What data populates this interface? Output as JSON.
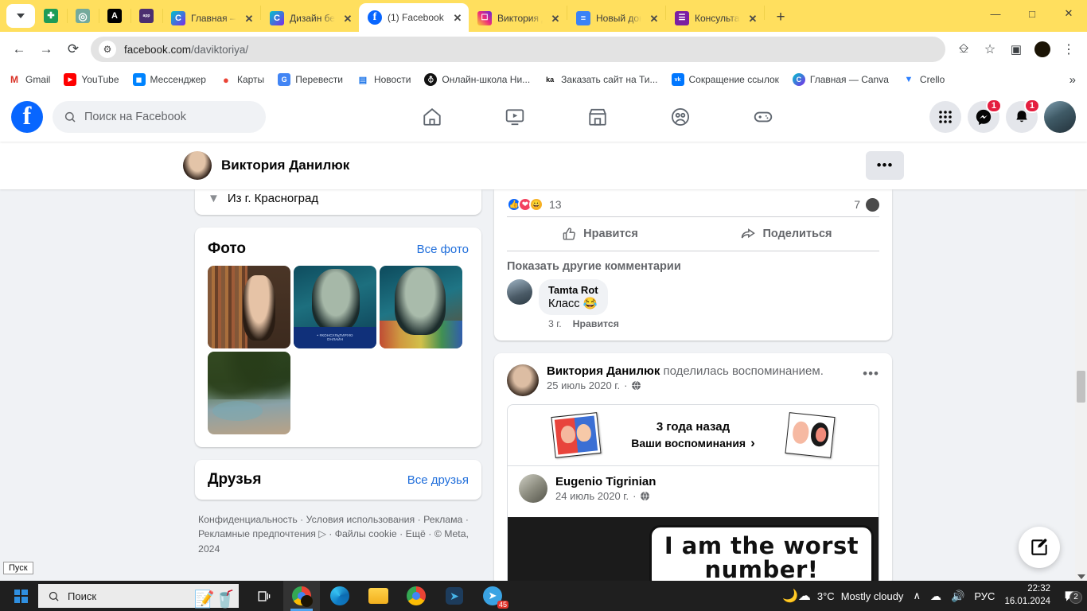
{
  "browser": {
    "tabs": [
      {
        "title": "",
        "favicon": "sheets-icon",
        "pinned": true,
        "color": "#1e9b57",
        "glyph": "✚"
      },
      {
        "title": "",
        "favicon": "chatgpt-icon",
        "pinned": true,
        "color": "#74aa9c",
        "glyph": "◎"
      },
      {
        "title": "",
        "favicon": "adobe-a-icon",
        "pinned": true,
        "color": "#000000",
        "glyph": "A"
      },
      {
        "title": "",
        "favicon": "purple-app-icon",
        "pinned": true,
        "color": "#4b2e70",
        "glyph": ""
      },
      {
        "title": "Главная — Canva",
        "favicon": "canva-icon",
        "pinned": false,
        "color": "#7d2ae8",
        "glyph": "C",
        "active": false
      },
      {
        "title": "Дизайн без названия",
        "favicon": "canva-icon",
        "pinned": false,
        "color": "#7d2ae8",
        "glyph": "C",
        "active": false
      },
      {
        "title": "(1) Facebook",
        "favicon": "facebook-icon",
        "pinned": false,
        "color": "#0866ff",
        "glyph": "f",
        "active": true
      },
      {
        "title": "Виктория Данилюк",
        "favicon": "instagram-icon",
        "pinned": false,
        "color": "#e1306c",
        "glyph": "▢",
        "active": false
      },
      {
        "title": "Новый документ",
        "favicon": "docs-icon",
        "pinned": false,
        "color": "#3b82f6",
        "glyph": "≡",
        "active": false
      },
      {
        "title": "Консультации",
        "favicon": "forms-icon",
        "pinned": false,
        "color": "#7b1fa2",
        "glyph": "☰",
        "active": false
      }
    ],
    "close_label": "✕",
    "new_tab_label": "+",
    "window_controls": {
      "minimize": "—",
      "maximize": "□",
      "close": "✕"
    },
    "nav": {
      "back": "←",
      "forward": "→",
      "reload": "⟳"
    },
    "address": {
      "domain": "facebook.com",
      "path": "/daviktoriya/",
      "site_info_icon": "tune-icon"
    },
    "toolbar_icons": [
      "cast-icon",
      "bookmark-star-icon",
      "side-panel-icon",
      "profile-avatar-icon",
      "chrome-menu-icon"
    ],
    "bookmarks": [
      {
        "label": "Gmail",
        "icon": "gmail-icon",
        "color": "#ffffff",
        "glyph": "M",
        "text_color": "#d93025"
      },
      {
        "label": "YouTube",
        "icon": "youtube-icon",
        "color": "#ff0000",
        "glyph": "▶",
        "text_color": "#ffffff"
      },
      {
        "label": "Мессенджер",
        "icon": "messenger-icon",
        "color": "#0084ff",
        "glyph": "■",
        "text_color": "#ffffff"
      },
      {
        "label": "Карты",
        "icon": "maps-icon",
        "color": "#ffffff",
        "glyph": "◉",
        "text_color": "#ea4335"
      },
      {
        "label": "Перевести",
        "icon": "translate-icon",
        "color": "#4285f4",
        "glyph": "G",
        "text_color": "#ffffff"
      },
      {
        "label": "Новости",
        "icon": "news-icon",
        "color": "#ffffff",
        "glyph": "▤",
        "text_color": "#1a73e8"
      },
      {
        "label": "Онлайн-школа Ни...",
        "icon": "globe-icon",
        "color": "#111111",
        "glyph": "⊕",
        "text_color": "#ffffff"
      },
      {
        "label": "Заказать сайт на Ти...",
        "icon": "ka-icon",
        "color": "#ffffff",
        "glyph": "ka",
        "text_color": "#111111"
      },
      {
        "label": "Сокращение ссылок",
        "icon": "vk-icon",
        "color": "#0077ff",
        "glyph": "vk",
        "text_color": "#ffffff"
      },
      {
        "label": "Главная — Canva",
        "icon": "canva-icon",
        "color": "#7d2ae8",
        "glyph": "C",
        "text_color": "#ffffff"
      },
      {
        "label": "Crello",
        "icon": "crello-icon",
        "color": "#ffffff",
        "glyph": "▼",
        "text_color": "#2b7fff"
      }
    ],
    "bookmarks_overflow": "»"
  },
  "facebook": {
    "logo_glyph": "f",
    "search_placeholder": "Поиск на Facebook",
    "nav_items": [
      {
        "name": "home-icon"
      },
      {
        "name": "video-icon"
      },
      {
        "name": "marketplace-icon"
      },
      {
        "name": "groups-icon"
      },
      {
        "name": "gaming-icon"
      }
    ],
    "right_icons": {
      "menu_label": "apps-grid-icon",
      "messenger_badge": "1",
      "notifications_badge": "1"
    },
    "profile_bar": {
      "name": "Виктория Данилюк",
      "more_label": "•••"
    },
    "intro_clipped_text": "Из г. Красноград",
    "photos_card": {
      "title": "Фото",
      "link": "Все фото",
      "photo_overlay_line1": "• #КОНСУЛЬТИРУЮ",
      "photo_overlay_line2": "ОНЛАЙН",
      "count": 4
    },
    "friends_card": {
      "title": "Друзья",
      "link": "Все друзья"
    },
    "footer": "Конфиденциальность · Условия использования · Реклама · Рекламные предпочтения ▷ · Файлы cookie · Ещё · © Meta, 2024",
    "post_reactions": {
      "count": "13",
      "comment_count": "7",
      "like_label": "Нравится",
      "share_label": "Поделиться",
      "show_more_comments": "Показать другие комментарии"
    },
    "comment": {
      "author": "Tamta Rot",
      "text": "Класс 😂",
      "time": "3 г.",
      "like_label": "Нравится"
    },
    "memory_post": {
      "author": "Виктория Данилюк",
      "action": "поделилась воспоминанием.",
      "date": "25 июль 2020 г.",
      "privacy_icon": "globe-icon",
      "more_label": "•••",
      "memory_title": "3 года назад",
      "memory_link": "Ваши воспоминания",
      "memory_chevron": "›",
      "inner_author": "Eugenio Tigrinian",
      "inner_date": "24 июль 2020 г.",
      "meme_line1": "I am the worst",
      "meme_line2": "number!"
    },
    "fab": "create-post-icon"
  },
  "os": {
    "start_tooltip": "Пуск",
    "taskbar_search_placeholder": "Поиск",
    "taskbar_apps": [
      "task-view-icon",
      "chrome-gold-icon",
      "edge-icon",
      "explorer-icon",
      "chrome-icon",
      "telegram-blue-icon",
      "telegram-icon"
    ],
    "telegram_badge": "45",
    "weather_temp": "3°C",
    "weather_desc": "Mostly cloudy",
    "tray": {
      "expand": "∧",
      "onedrive": "☁",
      "volume": "🔊",
      "lang": "РУС"
    },
    "clock_time": "22:32",
    "clock_date": "16.01.2024",
    "notif_count": "2"
  }
}
